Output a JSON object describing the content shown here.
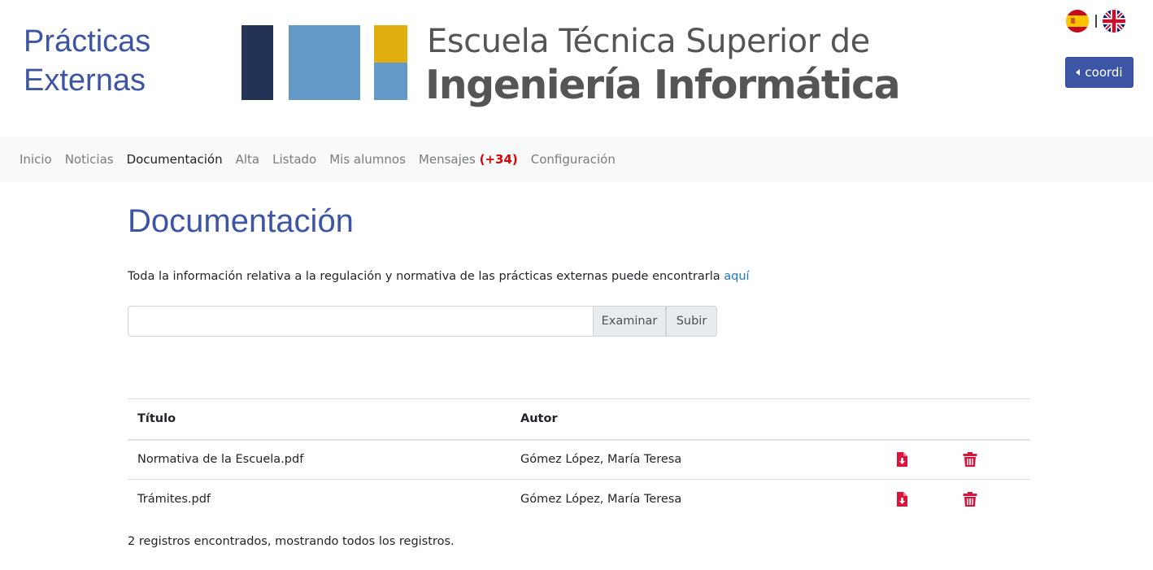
{
  "header": {
    "app_title_line1": "Prácticas",
    "app_title_line2": "Externas",
    "logo_line1": "Escuela Técnica Superior de",
    "logo_line2": "Ingeniería Informática",
    "languages": [
      "es",
      "en"
    ],
    "user_button_label": "coordi"
  },
  "nav": {
    "items": [
      {
        "label": "Inicio"
      },
      {
        "label": "Noticias"
      },
      {
        "label": "Documentación",
        "active": true
      },
      {
        "label": "Alta"
      },
      {
        "label": "Listado"
      },
      {
        "label": "Mis alumnos"
      },
      {
        "label": "Mensajes",
        "badge": "(+34)"
      },
      {
        "label": "Configuración"
      }
    ]
  },
  "main": {
    "title": "Documentación",
    "intro_text": "Toda la información relativa a la regulación y normativa de las prácticas externas puede encontrarla ",
    "intro_link": "aquí",
    "upload": {
      "file_value": "",
      "browse_label": "Examinar",
      "submit_label": "Subir"
    },
    "table": {
      "columns": [
        "Título",
        "Autor"
      ],
      "rows": [
        {
          "title": "Normativa de la Escuela.pdf",
          "author": "Gómez López, María Teresa"
        },
        {
          "title": "Trámites.pdf",
          "author": "Gómez López, María Teresa"
        }
      ]
    },
    "records_text": "2 registros encontrados, mostrando todos los registros."
  },
  "colors": {
    "brand_blue": "#3c55a5",
    "logo_dark": "#233356",
    "logo_light": "#6399c6",
    "logo_yellow": "#e0ae10",
    "action_red": "#dc143c",
    "badge_red": "#e00000"
  },
  "icons": {
    "download": "file-download-icon",
    "delete": "trash-icon",
    "caret": "caret-left-icon"
  }
}
